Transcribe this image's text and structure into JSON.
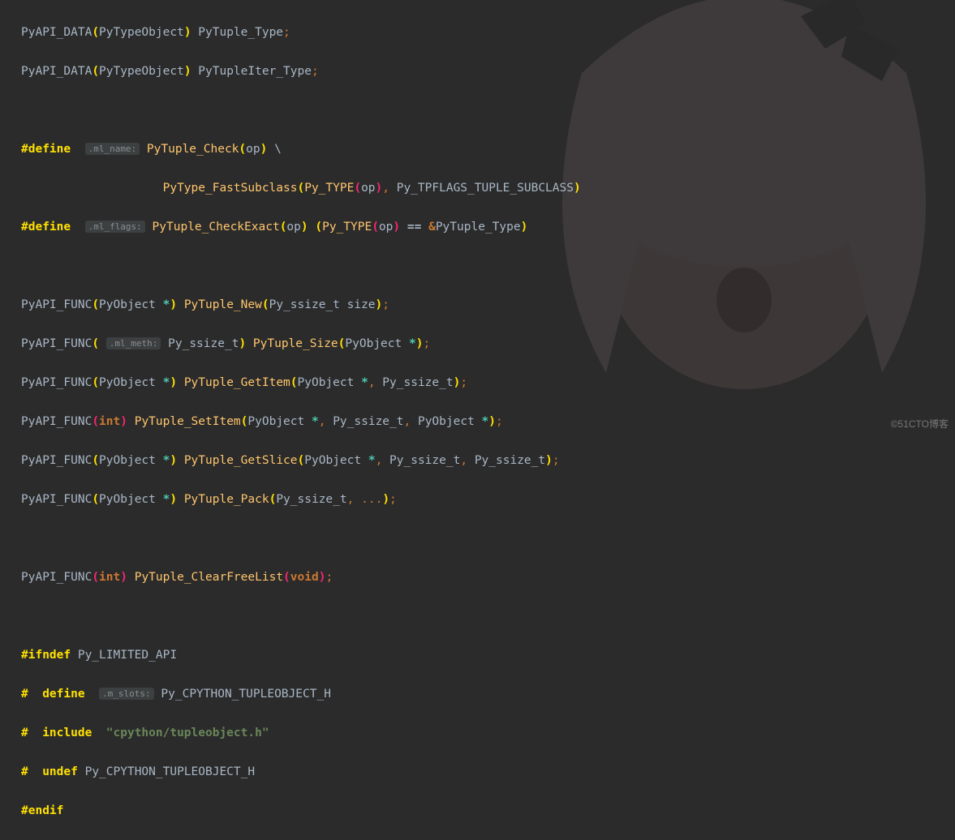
{
  "watermark": "©51CTO博客",
  "hints": {
    "ml_name": ".ml_name:",
    "ml_flags": ".ml_flags:",
    "ml_meth": ".ml_meth:",
    "m_slots": ".m_slots:"
  },
  "code": {
    "l1_a": "PyAPI_DATA",
    "l1_b": "PyTypeObject",
    "l1_c": " PyTuple_Type",
    "l2_a": "PyAPI_DATA",
    "l2_b": "PyTypeObject",
    "l2_c": " PyTupleIter_Type",
    "l4_def": "#define",
    "l4_fn": "PyTuple_Check",
    "l4_arg": "op",
    "l4_bs": " \\",
    "l5_pad": "                    ",
    "l5_fn": "PyType_FastSubclass",
    "l5_pt": "Py_TYPE",
    "l5_arg": "op",
    "l5_flag": " Py_TPFLAGS_TUPLE_SUBCLASS",
    "l6_def": "#define",
    "l6_fn": "PyTuple_CheckExact",
    "l6_arg": "op",
    "l6_pt": "Py_TYPE",
    "l6_eq": "==",
    "l6_ty": "PyTuple_Type",
    "pyapi_func": "PyAPI_FUNC",
    "pyobject": "PyObject ",
    "pyssize": "Py_ssize_t",
    "l8_fn": "PyTuple_New",
    "l8_arg": "Py_ssize_t size",
    "l9_ret": "Py_ssize_t",
    "l9_fn": "PyTuple_Size",
    "l10_fn": "PyTuple_GetItem",
    "l11_fn": "PyTuple_SetItem",
    "l11_ret": "int",
    "l12_fn": "PyTuple_GetSlice",
    "l13_fn": "PyTuple_Pack",
    "l13_dots": "...",
    "l15_fn": "PyTuple_ClearFreeList",
    "l15_ret": "int",
    "l15_void": "void",
    "l17": "#ifndef",
    "l17_b": " Py_LIMITED_API",
    "l18_a": "#",
    "l18_b": "define",
    "l18_c": "Py_CPYTHON_TUPLEOBJECT_H",
    "l19_a": "#",
    "l19_b": "include",
    "l19_c": "\"cpython/tupleobject.h\"",
    "l20_a": "#",
    "l20_b": "undef",
    "l20_c": " Py_CPYTHON_TUPLEOBJECT_H",
    "l21": "#endif"
  }
}
